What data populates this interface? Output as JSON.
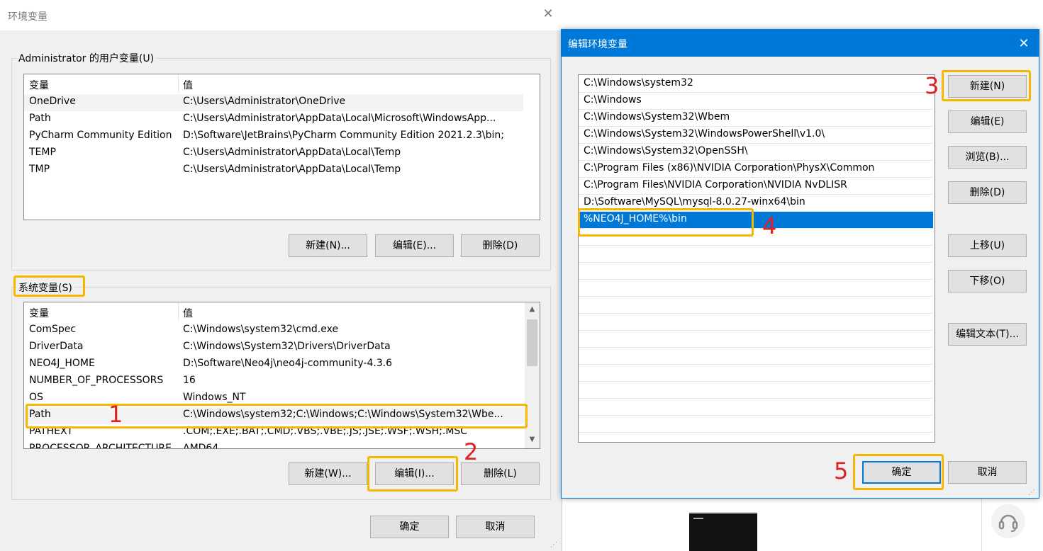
{
  "env_dialog": {
    "title": "环境变量",
    "close_glyph": "✕",
    "user_group": {
      "legend": "Administrator 的用户变量(U)",
      "columns": [
        "变量",
        "值"
      ],
      "rows": [
        {
          "name": "OneDrive",
          "value": "C:\\Users\\Administrator\\OneDrive"
        },
        {
          "name": "Path",
          "value": "C:\\Users\\Administrator\\AppData\\Local\\Microsoft\\WindowsApp..."
        },
        {
          "name": "PyCharm Community Edition",
          "value": "D:\\Software\\JetBrains\\PyCharm Community Edition 2021.2.3\\bin;"
        },
        {
          "name": "TEMP",
          "value": "C:\\Users\\Administrator\\AppData\\Local\\Temp"
        },
        {
          "name": "TMP",
          "value": "C:\\Users\\Administrator\\AppData\\Local\\Temp"
        }
      ],
      "buttons": {
        "new": "新建(N)...",
        "edit": "编辑(E)...",
        "delete": "删除(D)"
      }
    },
    "system_group": {
      "legend": "系统变量(S)",
      "columns": [
        "变量",
        "值"
      ],
      "rows": [
        {
          "name": "ComSpec",
          "value": "C:\\Windows\\system32\\cmd.exe"
        },
        {
          "name": "DriverData",
          "value": "C:\\Windows\\System32\\Drivers\\DriverData"
        },
        {
          "name": "NEO4J_HOME",
          "value": "D:\\Software\\Neo4j\\neo4j-community-4.3.6"
        },
        {
          "name": "NUMBER_OF_PROCESSORS",
          "value": "16"
        },
        {
          "name": "OS",
          "value": "Windows_NT"
        },
        {
          "name": "Path",
          "value": "C:\\Windows\\system32;C:\\Windows;C:\\Windows\\System32\\Wbe..."
        },
        {
          "name": "PATHEXT",
          "value": ".COM;.EXE;.BAT;.CMD;.VBS;.VBE;.JS;.JSE;.WSF;.WSH;.MSC"
        },
        {
          "name": "PROCESSOR_ARCHITECTURE",
          "value": "AMD64"
        }
      ],
      "buttons": {
        "new": "新建(W)...",
        "edit": "编辑(I)...",
        "delete": "删除(L)"
      }
    },
    "ok": "确定",
    "cancel": "取消"
  },
  "edit_dialog": {
    "title": "编辑环境变量",
    "close_glyph": "✕",
    "paths": [
      "C:\\Windows\\system32",
      "C:\\Windows",
      "C:\\Windows\\System32\\Wbem",
      "C:\\Windows\\System32\\WindowsPowerShell\\v1.0\\",
      "C:\\Windows\\System32\\OpenSSH\\",
      "C:\\Program Files (x86)\\NVIDIA Corporation\\PhysX\\Common",
      "C:\\Program Files\\NVIDIA Corporation\\NVIDIA NvDLISR",
      "D:\\Software\\MySQL\\mysql-8.0.27-winx64\\bin",
      "%NEO4J_HOME%\\bin"
    ],
    "selected_index": 8,
    "buttons": {
      "new": "新建(N)",
      "edit": "编辑(E)",
      "browse": "浏览(B)...",
      "delete": "删除(D)",
      "move_up": "上移(U)",
      "move_down": "下移(O)",
      "edit_text": "编辑文本(T)..."
    },
    "ok": "确定",
    "cancel": "取消"
  },
  "annotations": [
    "1",
    "2",
    "3",
    "4",
    "5"
  ],
  "colors": {
    "highlight": "#f5b700",
    "annotation": "#e02020",
    "accent": "#0078d7"
  }
}
